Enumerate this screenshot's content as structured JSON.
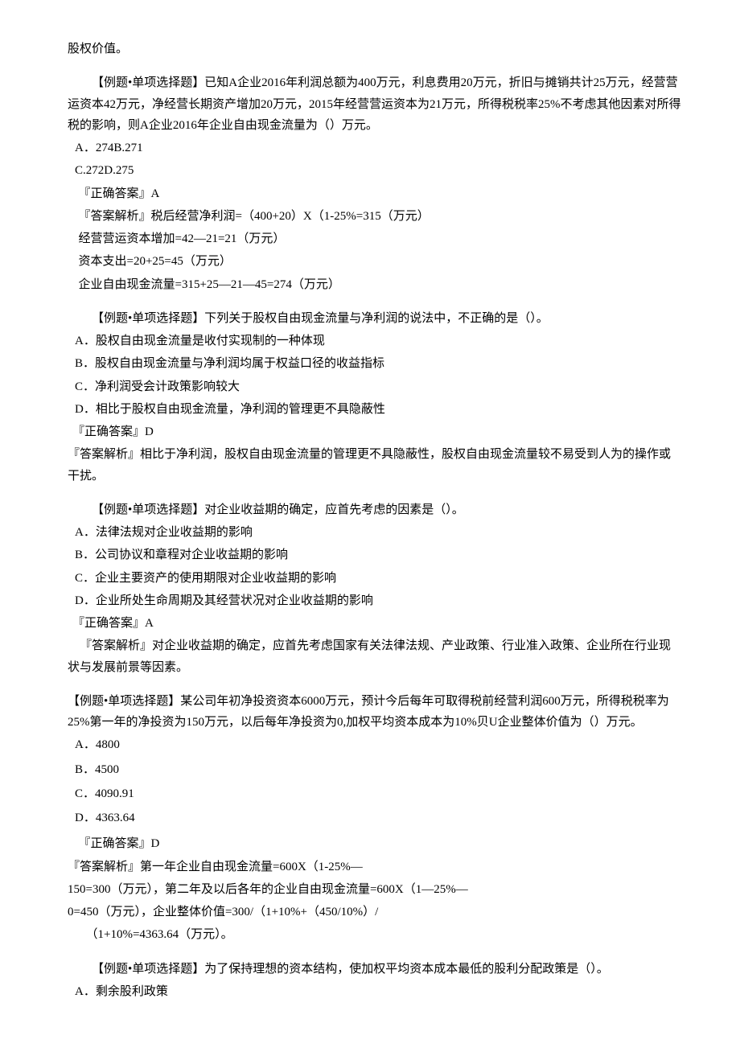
{
  "intro": "股权价值。",
  "q1": {
    "stem": "【例题•单项选择题】已知A企业2016年利润总额为400万元，利息费用20万元，折旧与摊销共计25万元，经营营运资本42万元，净经营长期资产增加20万元，2015年经营营运资本为21万元，所得税税率25%不考虑其他因素对所得税的影响，则A企业2016年企业自由现金流量为（）万元。",
    "optA": "A．274B.271",
    "optC": "C.272D.275",
    "ans": "『正确答案』A",
    "exp1": "『答案解析』税后经营净利润=（400+20）X（1-25%=315（万元）",
    "exp2": "经营营运资本增加=42—21=21（万元）",
    "exp3": "资本支出=20+25=45（万元）",
    "exp4": "企业自由现金流量=315+25—21—45=274（万元）"
  },
  "q2": {
    "stem": "【例题•单项选择题】下列关于股权自由现金流量与净利润的说法中，不正确的是（）。",
    "optA": "A．股权自由现金流量是收付实现制的一种体现",
    "optB": "B．股权自由现金流量与净利润均属于权益口径的收益指标",
    "optC": "C．净利润受会计政策影响较大",
    "optD": "D．相比于股权自由现金流量，净利润的管理更不具隐蔽性",
    "ans": "『正确答案』D",
    "exp": "『答案解析』相比于净利润，股权自由现金流量的管理更不具隐蔽性，股权自由现金流量较不易受到人为的操作或干扰。"
  },
  "q3": {
    "stem": "【例题•单项选择题】对企业收益期的确定，应首先考虑的因素是（）。",
    "optA": "A．法律法规对企业收益期的影响",
    "optB": "B．公司协议和章程对企业收益期的影响",
    "optC": "C．企业主要资产的使用期限对企业收益期的影响",
    "optD": "D．企业所处生命周期及其经营状况对企业收益期的影响",
    "ans": "『正确答案』A",
    "exp": "『答案解析』对企业收益期的确定，应首先考虑国家有关法律法规、产业政策、行业准入政策、企业所在行业现状与发展前景等因素。"
  },
  "q4": {
    "stem": "【例题•单项选择题】某公司年初净投资资本6000万元，预计今后每年可取得税前经营利润600万元，所得税税率为25%第一年的净投资为150万元，以后每年净投资为0,加权平均资本成本为10%贝U企业整体价值为（）万元。",
    "optA": "A．4800",
    "optB": "B．4500",
    "optC": "C．4090.91",
    "optD": "D．4363.64",
    "ans": "『正确答案』D",
    "exp1": "『答案解析』第一年企业自由现金流量=600X（1-25%—",
    "exp2": "150=300（万元），第二年及以后各年的企业自由现金流量=600X（1—25%—",
    "exp3": "0=450（万元），企业整体价值=300/（1+10%+（450/10%）/",
    "exp4": "（1+10%=4363.64（万元）。"
  },
  "q5": {
    "stem": "【例题•单项选择题】为了保持理想的资本结构，使加权平均资本成本最低的股利分配政策是（）。",
    "optA": "A．剩余股利政策"
  }
}
